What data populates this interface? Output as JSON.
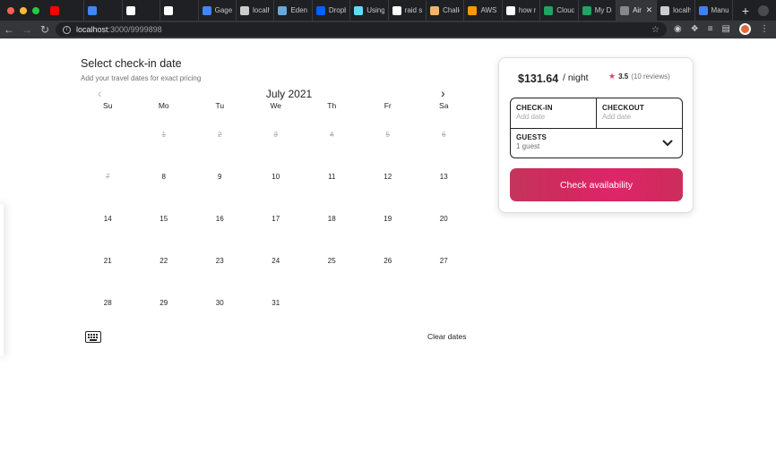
{
  "browser": {
    "traffic_lights": [
      "#fe5f57",
      "#febc2e",
      "#28c840"
    ],
    "tabs": [
      {
        "label": "",
        "icon": "youtube-icon",
        "color": "#ff0000"
      },
      {
        "label": "",
        "icon": "docs-icon",
        "color": "#4285f4"
      },
      {
        "label": "",
        "icon": "frame-icon",
        "color": "#ffffff"
      },
      {
        "label": "",
        "icon": "frame-icon",
        "color": "#ffffff"
      },
      {
        "label": "Gage",
        "icon": "docs-icon",
        "color": "#4285f4"
      },
      {
        "label": "localh",
        "icon": "globe-icon",
        "color": "#cccccc"
      },
      {
        "label": "Eden",
        "icon": "image-icon",
        "color": "#6aa8d8"
      },
      {
        "label": "Dropb",
        "icon": "dropbox-icon",
        "color": "#0061ff"
      },
      {
        "label": "Using",
        "icon": "react-icon",
        "color": "#61dafb"
      },
      {
        "label": "raid si",
        "icon": "google-icon",
        "color": "#ffffff"
      },
      {
        "label": "Challe",
        "icon": "hand-icon",
        "color": "#f2b36b"
      },
      {
        "label": "AWS F",
        "icon": "aws-icon",
        "color": "#f90"
      },
      {
        "label": "how n",
        "icon": "google-icon",
        "color": "#ffffff"
      },
      {
        "label": "Cloud",
        "icon": "drive-icon",
        "color": "#1fa463"
      },
      {
        "label": "My Dr",
        "icon": "drive-icon",
        "color": "#1fa463"
      },
      {
        "label": "Air",
        "icon": "globe-icon",
        "color": "#888888",
        "active": true
      },
      {
        "label": "localh",
        "icon": "globe-icon",
        "color": "#cccccc"
      },
      {
        "label": "Manu",
        "icon": "cube-icon",
        "color": "#3b82f6"
      }
    ],
    "url_host": "localhost",
    "url_path": ":3000/9999898"
  },
  "calendar": {
    "title": "Select check-in date",
    "subtitle": "Add your travel dates for exact pricing",
    "month": "July 2021",
    "weekdays": [
      "Su",
      "Mo",
      "Tu",
      "We",
      "Th",
      "Fr",
      "Sa"
    ],
    "weeks": [
      [
        "",
        "1",
        "2",
        "3",
        "4",
        "5",
        "6"
      ],
      [
        "7",
        "8",
        "9",
        "10",
        "11",
        "12",
        "13"
      ],
      [
        "14",
        "15",
        "16",
        "17",
        "18",
        "19",
        "20"
      ],
      [
        "21",
        "22",
        "23",
        "24",
        "25",
        "26",
        "27"
      ],
      [
        "28",
        "29",
        "30",
        "31",
        "",
        "",
        ""
      ]
    ],
    "past_days": [
      "1",
      "2",
      "3",
      "4",
      "5",
      "6",
      "7"
    ],
    "clear_label": "Clear dates"
  },
  "booking": {
    "price": "$131.64",
    "per": "/ night",
    "rating": "3.5",
    "reviews": "(10 reviews)",
    "checkin_label": "CHECK-IN",
    "checkin_placeholder": "Add date",
    "checkout_label": "CHECKOUT",
    "checkout_placeholder": "Add date",
    "guests_label": "GUESTS",
    "guests_value": "1 guest",
    "cta_label": "Check availability",
    "accent": "#e0256a"
  }
}
